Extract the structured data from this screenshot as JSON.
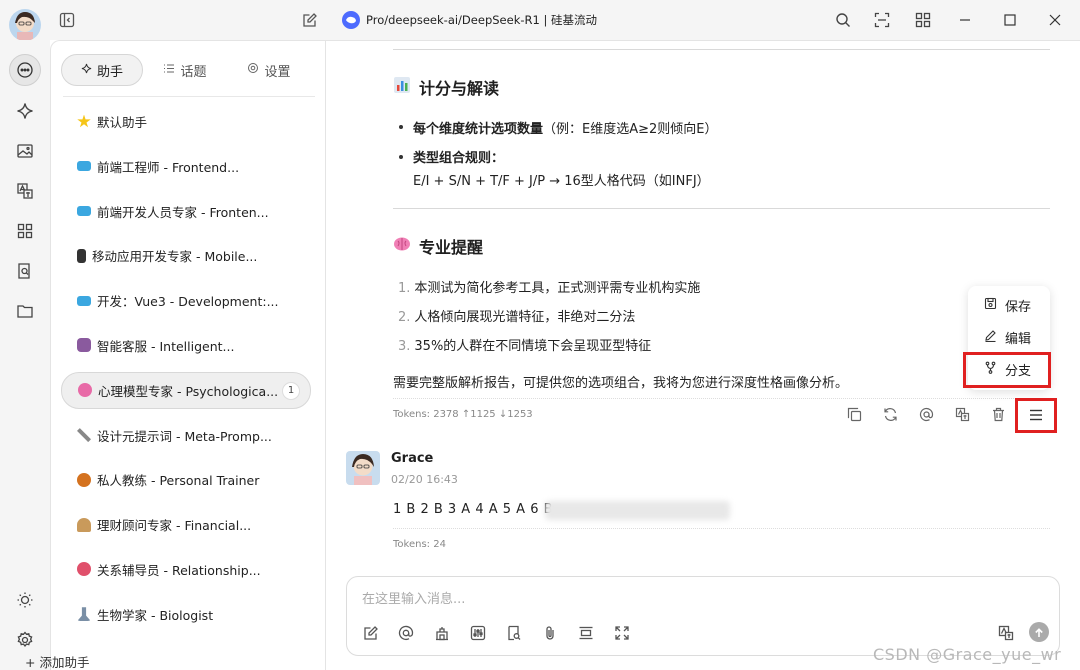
{
  "titlebar": {
    "tab_title": "Pro/deepseek-ai/DeepSeek-R1 | 硅基流动"
  },
  "sidebar_tabs": {
    "assistant": "助手",
    "topics": "话题",
    "settings": "设置"
  },
  "assistants": [
    {
      "label": "默认助手",
      "color": "#f5c518"
    },
    {
      "label": "前端工程师 - Frontend...",
      "color": "#3ba7e0"
    },
    {
      "label": "前端开发人员专家 - Fronten...",
      "color": "#3ba7e0"
    },
    {
      "label": "移动应用开发专家 - Mobile...",
      "color": "#333333"
    },
    {
      "label": "开发：Vue3 - Development:...",
      "color": "#3ba7e0"
    },
    {
      "label": "智能客服 - Intelligent...",
      "color": "#8a5a9e"
    },
    {
      "label": "心理模型专家 - Psychologica...",
      "color": "#e86aa7",
      "badge": "1"
    },
    {
      "label": "设计元提示词 - Meta-Promp...",
      "color": "#888888"
    },
    {
      "label": "私人教练 - Personal Trainer",
      "color": "#d4721f"
    },
    {
      "label": "理财顾问专家 - Financial...",
      "color": "#c99a5b"
    },
    {
      "label": "关系辅导员 - Relationship...",
      "color": "#e0506b"
    },
    {
      "label": "生物学家 - Biologist",
      "color": "#7a8fa6"
    }
  ],
  "add_assistant": "+ 添加助手",
  "message": {
    "section1_title": "计分与解读",
    "section1_bullets": [
      {
        "bold": "每个维度统计选项数量",
        "rest": "（例：E维度选A≥2则倾向E）"
      },
      {
        "bold": "类型组合规则：",
        "rest": ""
      }
    ],
    "section1_rule": "E/I + S/N + T/F + J/P → 16型人格代码（如INFJ）",
    "section2_title": "专业提醒",
    "section2_items": [
      {
        "num": "1.",
        "text": "本测试为简化参考工具，正式测评需专业机构实施"
      },
      {
        "num": "2.",
        "text": "人格倾向展现光谱特征，非绝对二分法"
      },
      {
        "num": "3.",
        "text": "35%的人群在不同情境下会呈现亚型特征"
      }
    ],
    "closing": "需要完整版解析报告，可提供您的选项组合，我将为您进行深度性格画像分析。",
    "tokens": "Tokens: 2378 ↑1125 ↓1253"
  },
  "context_menu": {
    "save": "保存",
    "edit": "编辑",
    "branch": "分支"
  },
  "user_message": {
    "name": "Grace",
    "time": "02/20 16:43",
    "text": "1 B 2 B 3 A 4 A 5 A 6 B",
    "tokens": "Tokens: 24"
  },
  "input": {
    "placeholder": "在这里输入消息..."
  },
  "watermark": "CSDN @Grace_yue_wr"
}
